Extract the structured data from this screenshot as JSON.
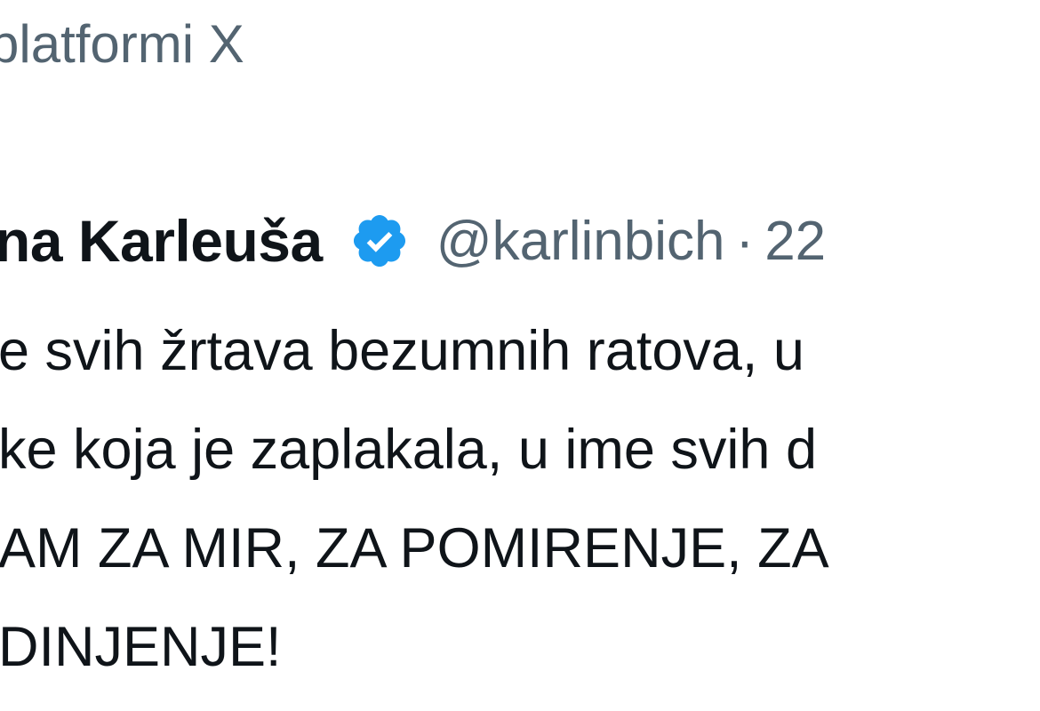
{
  "header": {
    "caption": "platformi X"
  },
  "post": {
    "author_name": "na Karleuša",
    "verified_icon": "verified-badge-icon",
    "handle": "@karlinbich",
    "separator": "·",
    "timestamp": "22",
    "lines": [
      "e svih žrtava bezumnih ratova, u",
      "ke koja je zaplakala, u ime svih d",
      "AM ZA MIR, ZA POMIRENJE, ZA",
      "DINJENJE!"
    ]
  },
  "colors": {
    "text_primary": "#0f1419",
    "text_secondary": "#536471",
    "verified_blue": "#1d9bf0",
    "background": "#ffffff"
  }
}
